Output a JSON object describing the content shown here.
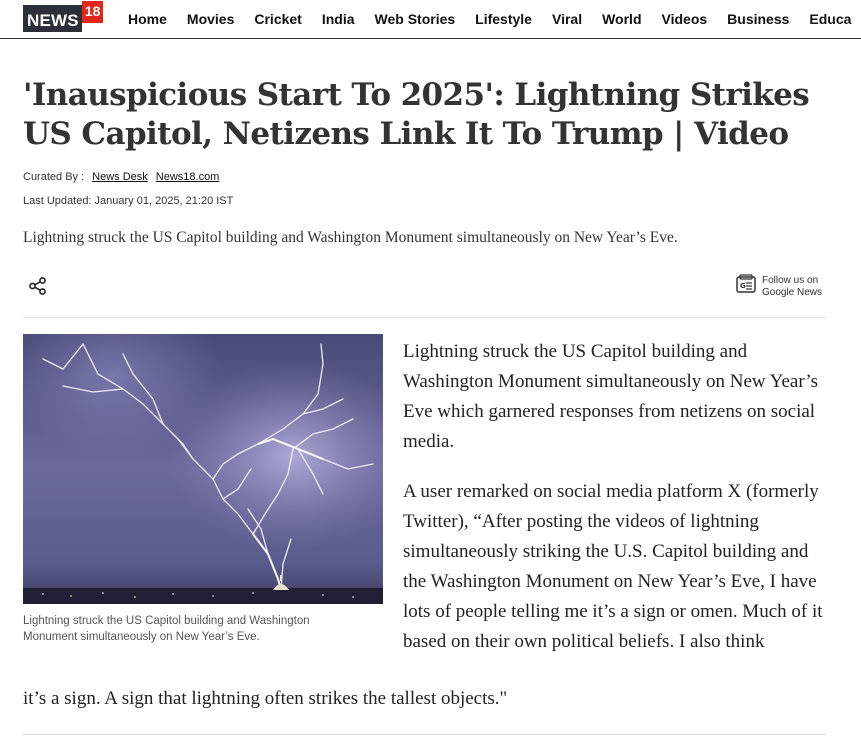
{
  "header": {
    "logo_text": "NEWS",
    "logo_number": "18",
    "nav": [
      "Home",
      "Movies",
      "Cricket",
      "India",
      "Web Stories",
      "Lifestyle",
      "Viral",
      "World",
      "Videos",
      "Business",
      "Educa"
    ]
  },
  "article": {
    "headline": "'Inauspicious Start To 2025': Lightning Strikes US Capitol, Netizens Link It To Trump | Video",
    "curated_by_label": "Curated By :",
    "authors": [
      "News Desk",
      "News18.com"
    ],
    "last_updated": "Last Updated: January 01, 2025, 21:20 IST",
    "summary": "Lightning struck the US Capitol building and Washington Monument simultaneously on New Year’s Eve.",
    "follow_line1": "Follow us on",
    "follow_line2": "Google News",
    "image_caption": "Lightning struck the US Capitol building and Washington Monument simultaneously on New Year’s Eve.",
    "paragraph1": "Lightning struck the US Capitol building and Washington Monument simultaneously on New Year’s Eve which garnered responses from netizens on social media.",
    "paragraph2_main": "A user remarked on social media platform X (formerly Twitter), “After posting the videos of lightning simultaneously striking the U.S. Capitol building and the Washington Monument on New Year’s Eve, I have lots of people telling me it’s a sign or omen. Much of it based on their own political beliefs. I also think",
    "paragraph2_tail": "it’s a sign. A sign that lightning often strikes the tallest objects.\""
  },
  "icons": {
    "share": "share-icon",
    "google_news": "google-news-icon"
  },
  "colors": {
    "brand_red": "#e1261c",
    "brand_dark": "#2b2f38",
    "sky": "#5a5a8a"
  }
}
